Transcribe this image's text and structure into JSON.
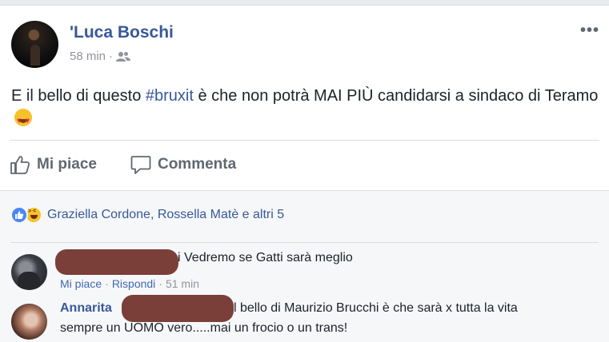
{
  "post": {
    "author": "'Luca Boschi",
    "time": "58 min",
    "separator": "·",
    "more_icon": "•••",
    "text_before": "E il bello di questo ",
    "hashtag": "#bruxit",
    "text_after": " è che non potrà MAI PIÙ candidarsi a sindaco di Teramo"
  },
  "actions": {
    "like_label": "Mi piace",
    "comment_label": "Commenta"
  },
  "reactions": {
    "names": "Graziella Cordone, Rossella Matè e altri 5"
  },
  "comments": [
    {
      "author": "",
      "text": "i Vedremo se Gatti sarà meglio",
      "like_label": "Mi piace",
      "reply_label": "Rispondi",
      "time": "51 min",
      "separator": "·"
    },
    {
      "author": "Annarita",
      "line1": "l bello di Maurizio Brucchi è che sarà x tutta la vita",
      "line2": "sempre un UOMO vero.....mai un frocio o un trans!"
    }
  ],
  "colors": {
    "link": "#385898",
    "background": "#e9ebee",
    "redaction": "#7a3f39"
  }
}
